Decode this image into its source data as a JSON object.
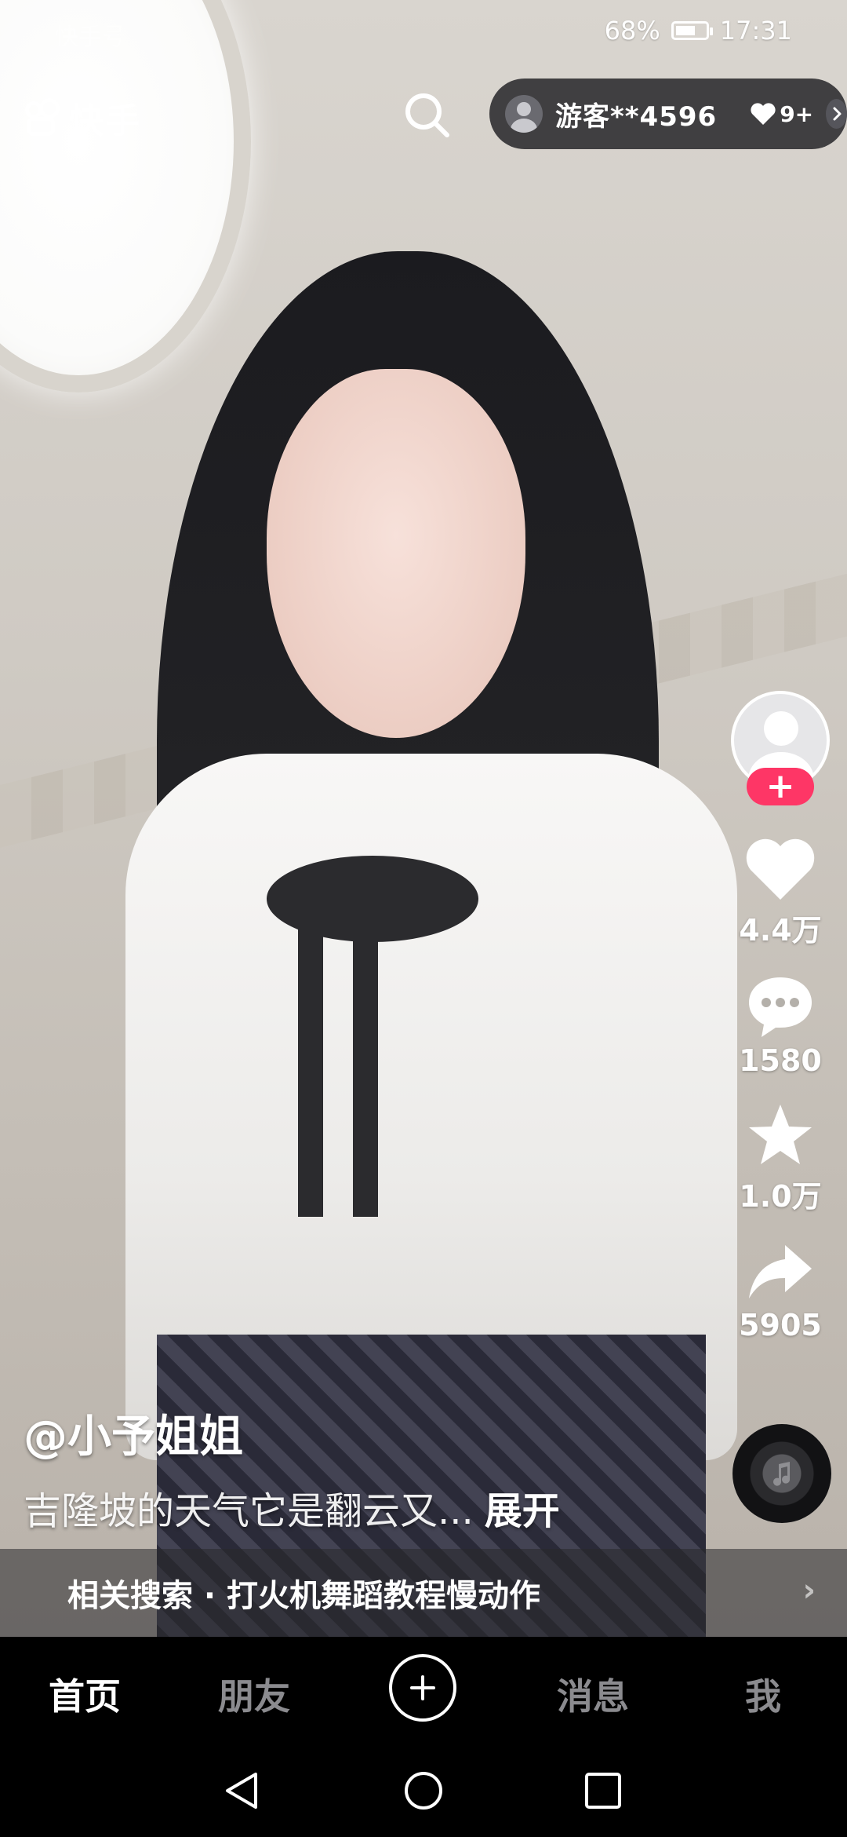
{
  "status_bar": {
    "watermark": "快手号",
    "battery": "68%",
    "battery_level": 0.68,
    "time": "17:31"
  },
  "top_bar": {
    "app_name": "快手",
    "search_icon": "search-icon",
    "user_pill": {
      "guest_name": "游客**4596",
      "likes_badge": "9+",
      "heart_icon": "heart-icon",
      "arrow_icon": "chevron-right-icon"
    }
  },
  "actions": {
    "follow_label": "+",
    "like_count": "4.4万",
    "comment_count": "1580",
    "favorite_count": "1.0万",
    "share_count": "5905"
  },
  "post": {
    "author": "@小予姐姐",
    "caption": "吉隆坡的天气它是翻云又...",
    "expand_label": "展开"
  },
  "related_search": {
    "label": "相关搜索 · 打火机舞蹈教程慢动作",
    "arrow": "›"
  },
  "tabs": [
    {
      "label": "首页",
      "active": true
    },
    {
      "label": "朋友",
      "active": false
    },
    {
      "label": "消息",
      "active": false
    },
    {
      "label": "我",
      "active": false
    }
  ],
  "nav": [
    "back-icon",
    "home-icon",
    "recents-icon"
  ],
  "colors": {
    "follow_accent": "#fe3666",
    "tab_active": "#ffffff",
    "tab_inactive": "#8b8b8f"
  }
}
